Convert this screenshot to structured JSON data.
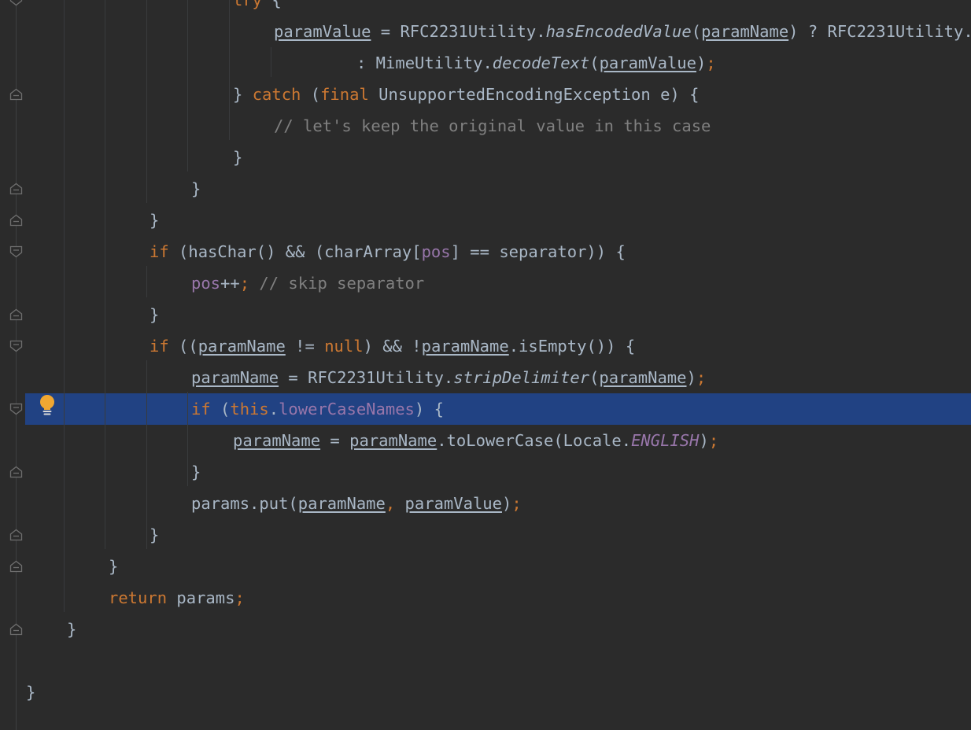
{
  "editor": {
    "highlighted_line": 13,
    "lines": [
      {
        "indent": 296,
        "tokens": [
          {
            "t": "try",
            "c": "kw"
          },
          {
            "t": " {"
          }
        ]
      },
      {
        "indent": 348,
        "tokens": [
          {
            "t": "paramValue",
            "c": "ul"
          },
          {
            "t": " = RFC2231Utility."
          },
          {
            "t": "hasEncodedValue",
            "c": "mi"
          },
          {
            "t": "("
          },
          {
            "t": "paramName",
            "c": "ul"
          },
          {
            "t": ") ? RFC2231Utility."
          }
        ]
      },
      {
        "indent": 453,
        "tokens": [
          {
            "t": ": MimeUtility."
          },
          {
            "t": "decodeText",
            "c": "mi"
          },
          {
            "t": "("
          },
          {
            "t": "paramValue",
            "c": "ul"
          },
          {
            "t": ")"
          },
          {
            "t": ";",
            "c": "kw"
          }
        ]
      },
      {
        "indent": 296,
        "tokens": [
          {
            "t": "} "
          },
          {
            "t": "catch",
            "c": "kw"
          },
          {
            "t": " ("
          },
          {
            "t": "final",
            "c": "kw"
          },
          {
            "t": " UnsupportedEncodingException e) {"
          }
        ]
      },
      {
        "indent": 348,
        "tokens": [
          {
            "t": "// let's keep the original value in this case",
            "c": "cm"
          }
        ]
      },
      {
        "indent": 296,
        "tokens": [
          {
            "t": "}"
          }
        ]
      },
      {
        "indent": 243,
        "tokens": [
          {
            "t": "}"
          }
        ]
      },
      {
        "indent": 190,
        "tokens": [
          {
            "t": "}"
          }
        ]
      },
      {
        "indent": 190,
        "tokens": [
          {
            "t": "if",
            "c": "kw"
          },
          {
            "t": " (hasChar() && (charArray["
          },
          {
            "t": "pos",
            "c": "fld"
          },
          {
            "t": "] == separator)) {"
          }
        ]
      },
      {
        "indent": 243,
        "tokens": [
          {
            "t": "pos",
            "c": "fld"
          },
          {
            "t": "++"
          },
          {
            "t": ";",
            "c": "kw"
          },
          {
            "t": " "
          },
          {
            "t": "// skip separator",
            "c": "cm"
          }
        ]
      },
      {
        "indent": 190,
        "tokens": [
          {
            "t": "}"
          }
        ]
      },
      {
        "indent": 190,
        "tokens": [
          {
            "t": "if",
            "c": "kw"
          },
          {
            "t": " (("
          },
          {
            "t": "paramName",
            "c": "ul"
          },
          {
            "t": " != "
          },
          {
            "t": "null",
            "c": "kw"
          },
          {
            "t": ") && !"
          },
          {
            "t": "paramName",
            "c": "ul"
          },
          {
            "t": ".isEmpty()) {"
          }
        ]
      },
      {
        "indent": 243,
        "tokens": [
          {
            "t": "paramName",
            "c": "ul"
          },
          {
            "t": " = RFC2231Utility."
          },
          {
            "t": "stripDelimiter",
            "c": "mi"
          },
          {
            "t": "("
          },
          {
            "t": "paramName",
            "c": "ul"
          },
          {
            "t": ")"
          },
          {
            "t": ";",
            "c": "kw"
          }
        ]
      },
      {
        "indent": 243,
        "tokens": [
          {
            "t": "if",
            "c": "kw"
          },
          {
            "t": " ("
          },
          {
            "t": "this",
            "c": "kw"
          },
          {
            "t": "."
          },
          {
            "t": "lowerCaseNames",
            "c": "fld"
          },
          {
            "t": ") {"
          }
        ]
      },
      {
        "indent": 296,
        "tokens": [
          {
            "t": "paramName",
            "c": "ul"
          },
          {
            "t": " = "
          },
          {
            "t": "paramName",
            "c": "ul"
          },
          {
            "t": ".toLowerCase(Locale."
          },
          {
            "t": "ENGLISH",
            "c": "st"
          },
          {
            "t": ")"
          },
          {
            "t": ";",
            "c": "kw"
          }
        ]
      },
      {
        "indent": 243,
        "tokens": [
          {
            "t": "}"
          }
        ]
      },
      {
        "indent": 243,
        "tokens": [
          {
            "t": "params.put("
          },
          {
            "t": "paramName",
            "c": "ul"
          },
          {
            "t": ", ",
            "c": "kw"
          },
          {
            "t": "paramValue",
            "c": "ul"
          },
          {
            "t": ")"
          },
          {
            "t": ";",
            "c": "kw"
          }
        ]
      },
      {
        "indent": 190,
        "tokens": [
          {
            "t": "}"
          }
        ]
      },
      {
        "indent": 138,
        "tokens": [
          {
            "t": "}"
          }
        ]
      },
      {
        "indent": 138,
        "tokens": [
          {
            "t": "return",
            "c": "kw"
          },
          {
            "t": " params"
          },
          {
            "t": ";",
            "c": "kw"
          }
        ]
      },
      {
        "indent": 85,
        "tokens": [
          {
            "t": "}"
          }
        ]
      },
      {
        "indent": 85,
        "tokens": []
      },
      {
        "indent": 33,
        "tokens": [
          {
            "t": "}"
          }
        ]
      }
    ]
  },
  "gutter": {
    "fold_markers": [
      {
        "line": 0,
        "kind": "open"
      },
      {
        "line": 3,
        "kind": "close"
      },
      {
        "line": 6,
        "kind": "close"
      },
      {
        "line": 7,
        "kind": "close"
      },
      {
        "line": 8,
        "kind": "open"
      },
      {
        "line": 10,
        "kind": "close"
      },
      {
        "line": 11,
        "kind": "open"
      },
      {
        "line": 13,
        "kind": "open"
      },
      {
        "line": 15,
        "kind": "close"
      },
      {
        "line": 17,
        "kind": "close"
      },
      {
        "line": 18,
        "kind": "close"
      },
      {
        "line": 20,
        "kind": "close"
      }
    ],
    "intention_icon": "lightbulb-icon"
  },
  "colors": {
    "background": "#2b2b2b",
    "highlight": "#214283",
    "keyword": "#cc7832",
    "field": "#9876aa",
    "comment": "#808080",
    "text": "#a9b7c6",
    "bulb": "#f0a732"
  }
}
